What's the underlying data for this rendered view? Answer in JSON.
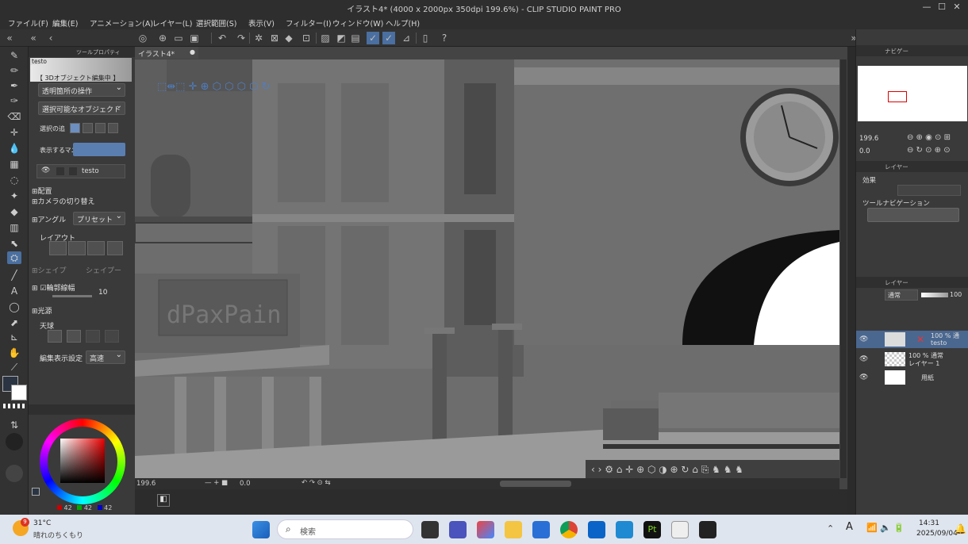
{
  "window": {
    "title": "イラスト4* (4000 x 2000px 350dpi 199.6%)  - CLIP STUDIO PAINT PRO",
    "controls": [
      "—",
      "☐",
      "✕"
    ]
  },
  "menu": [
    "ファイル(F)",
    "編集(E)",
    "アニメーション(A)",
    "レイヤー(L)",
    "選択範囲(S)",
    "表示(V)",
    "フィルター(I)",
    "ウィンドウ(W)",
    "ヘルプ(H)"
  ],
  "left_panel": {
    "tab_label": "ツールプロパティ",
    "layer_tag": "testo",
    "mode_header": "【 3Dオブジェクト編集中 】",
    "dropdown_1": "透明箇所の操作",
    "dropdown_2": "選択可能なオブジェクト",
    "select_label": "選択の追",
    "manip_label": "表示するマニピ",
    "object_name": "testo",
    "section_placement": "配置",
    "section_camera": "カメラの切り替え",
    "angle_label": "アングル",
    "preset_label": "プリセット",
    "layout_label": "レイアウト",
    "shape_label": "シェイプ",
    "shape_value": "シェイプー",
    "outline_label": "輪郭線幅",
    "outline_value": "10",
    "section_light": "光源",
    "sky_label": "天球",
    "display_label": "編集表示設定",
    "display_value": "高速"
  },
  "color": {
    "main": "#2a3442",
    "sub": "#ffffff",
    "r": "42",
    "g": "42",
    "b": "42"
  },
  "canvas": {
    "tab_label": "イラスト4*",
    "sign_text": "dPaxPain",
    "zoom": "199.6",
    "angle": "0.0"
  },
  "navigator": {
    "tab_label": "ナビゲー",
    "zoom": "199.6",
    "angle": "0.0"
  },
  "sub_tool": {
    "tab_label": "レイヤー",
    "effects_label": "効果",
    "nav_label": "ツールナビゲーション"
  },
  "layers": {
    "tab_label": "レイヤー",
    "blend_mode": "通常",
    "opacity": "100",
    "items": [
      {
        "line1": "100 % 通",
        "line2": "testo"
      },
      {
        "line1": "100 % 通常",
        "line2": "レイヤー 1"
      },
      {
        "line1": "",
        "line2": "用紙"
      }
    ]
  },
  "taskbar": {
    "weather_badge": "9",
    "temperature": "31°C",
    "weather_text": "晴れのちくもり",
    "search_placeholder": "検索",
    "ime": "A",
    "time": "14:31",
    "date": "2025/09/04"
  }
}
